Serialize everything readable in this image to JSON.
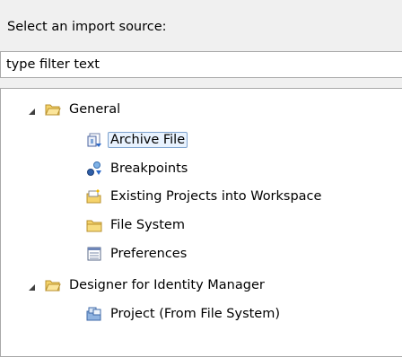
{
  "prompt_label": "Select an import source:",
  "filter": {
    "value": "type filter text"
  },
  "tree": [
    {
      "label": "General",
      "icon": "folder-open-icon",
      "expanded": true
    },
    {
      "label": "Archive File",
      "icon": "archive-file-icon",
      "selected": true
    },
    {
      "label": "Breakpoints",
      "icon": "breakpoints-icon"
    },
    {
      "label": "Existing Projects into Workspace",
      "icon": "existing-projects-icon"
    },
    {
      "label": "File System",
      "icon": "folder-icon"
    },
    {
      "label": "Preferences",
      "icon": "preferences-icon"
    },
    {
      "label": "Designer for Identity Manager",
      "icon": "folder-open-icon",
      "expanded": true
    },
    {
      "label": "Project (From File System)",
      "icon": "project-icon"
    }
  ],
  "colors": {
    "selection_fill": "#e8f2fe",
    "selection_border": "#7da2ce",
    "folder_yellow": "#f5d36b"
  }
}
